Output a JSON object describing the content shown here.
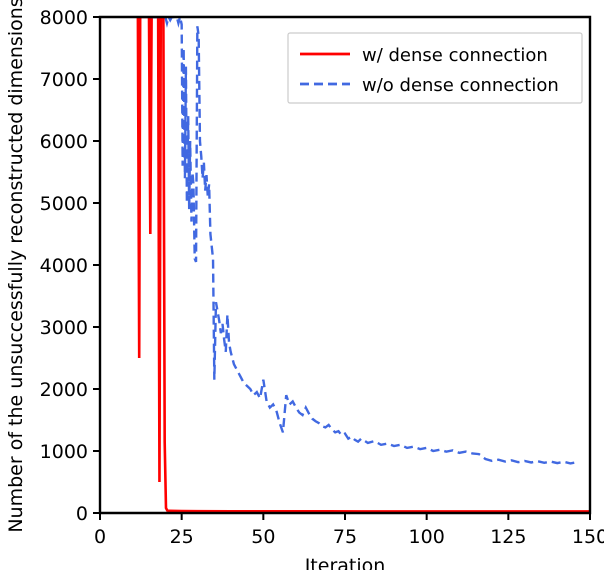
{
  "chart_data": {
    "type": "line",
    "title": "",
    "xlabel": "Iteration",
    "ylabel": "Number of the unsuccessfully reconstructed dimensions",
    "xlim": [
      0,
      150
    ],
    "ylim": [
      0,
      8000
    ],
    "xticks": [
      0,
      25,
      50,
      75,
      100,
      125,
      150
    ],
    "yticks": [
      0,
      1000,
      2000,
      3000,
      4000,
      5000,
      6000,
      7000,
      8000
    ],
    "xtick_labels": [
      "0",
      "25",
      "50",
      "75",
      "100",
      "125",
      "150"
    ],
    "ytick_labels": [
      "0",
      "1000",
      "2000",
      "3000",
      "4000",
      "5000",
      "6000",
      "7000",
      "8000"
    ],
    "grid": false,
    "legend_position": "upper right",
    "series": [
      {
        "name": "w/ dense connection",
        "color": "#ff0000",
        "linestyle": "solid",
        "linewidth": 2.6,
        "x": [
          11.6,
          12.0,
          12.3,
          12.6,
          13.0,
          13.4,
          13.8,
          14.2,
          14.6,
          15.0,
          15.4,
          15.8,
          16.2,
          16.6,
          17.0,
          17.4,
          17.8,
          18.2,
          18.6,
          19.0,
          19.4,
          19.8,
          20.2,
          20.6,
          21.0,
          25,
          30,
          40,
          50,
          60,
          70,
          80,
          90,
          100,
          110,
          120,
          130,
          140,
          150
        ],
        "y": [
          8000,
          2500,
          8000,
          8000,
          8000,
          8000,
          8000,
          8000,
          8000,
          8000,
          4500,
          8000,
          8000,
          8000,
          8000,
          8000,
          8000,
          500,
          8000,
          8000,
          8000,
          1150,
          80,
          40,
          35,
          32,
          30,
          28,
          28,
          27,
          27,
          26,
          26,
          25,
          25,
          25,
          25,
          25,
          25
        ]
      },
      {
        "name": "w/o dense connection",
        "color": "#4169e1",
        "linestyle": "dashed",
        "linewidth": 2.4,
        "x": [
          15.5,
          16,
          16.5,
          17,
          17.5,
          18,
          18.5,
          19,
          19.5,
          20,
          20.5,
          21,
          21.5,
          22,
          22.5,
          23,
          23.5,
          24,
          24.5,
          25,
          25.3,
          25.6,
          26,
          26.3,
          26.6,
          27,
          27.3,
          27.6,
          28,
          28.3,
          28.6,
          29,
          29.4,
          29.8,
          30.2,
          30.6,
          31,
          31.4,
          31.8,
          32.2,
          32.6,
          33,
          33.4,
          33.8,
          34.2,
          34.6,
          35,
          35.5,
          36,
          36.5,
          37,
          37.5,
          38,
          38.5,
          39,
          39.5,
          40,
          40.5,
          41,
          41.5,
          42,
          42.5,
          43,
          43.5,
          44,
          45,
          46,
          47,
          48,
          49,
          50,
          51,
          52,
          53,
          54,
          55,
          56,
          57,
          58,
          59,
          60,
          61,
          62,
          63,
          64,
          65,
          66,
          67,
          68,
          69,
          70,
          71,
          72,
          73,
          74,
          75,
          76,
          77,
          78,
          79,
          80,
          82,
          84,
          86,
          88,
          90,
          92,
          94,
          96,
          98,
          100,
          102,
          104,
          106,
          108,
          110,
          112,
          114,
          116,
          118,
          120,
          122,
          124,
          126,
          128,
          130,
          132,
          134,
          136,
          138,
          140,
          142,
          144,
          146,
          148,
          150
        ],
        "y": [
          8000,
          8000,
          8000,
          8000,
          8000,
          8000,
          8000,
          8000,
          8000,
          8000,
          7900,
          8000,
          7950,
          8000,
          8000,
          8000,
          8000,
          7900,
          8000,
          7880,
          5600,
          7500,
          5400,
          7200,
          5000,
          6400,
          4900,
          6000,
          4700,
          5500,
          5300,
          4100,
          4050,
          7850,
          7700,
          6000,
          5750,
          5400,
          5650,
          5200,
          5450,
          5100,
          5300,
          4500,
          4300,
          4100,
          2150,
          3400,
          3250,
          3100,
          2900,
          3050,
          2800,
          2600,
          3200,
          2750,
          2600,
          2500,
          2400,
          2350,
          2300,
          2250,
          2200,
          2150,
          2100,
          2050,
          2000,
          1900,
          1950,
          1850,
          2150,
          1800,
          1700,
          1750,
          1650,
          1450,
          1300,
          1900,
          1750,
          1800,
          1700,
          1620,
          1580,
          1700,
          1600,
          1520,
          1480,
          1450,
          1400,
          1380,
          1420,
          1350,
          1300,
          1320,
          1250,
          1280,
          1200,
          1230,
          1180,
          1150,
          1200,
          1130,
          1160,
          1100,
          1120,
          1080,
          1100,
          1050,
          1070,
          1030,
          1050,
          1000,
          1020,
          990,
          1010,
          970,
          990,
          960,
          950,
          870,
          840,
          860,
          830,
          850,
          820,
          840,
          815,
          835,
          810,
          830,
          805,
          825,
          800,
          820
        ]
      }
    ]
  },
  "legend": {
    "entries": [
      {
        "label": "w/ dense connection",
        "color": "#ff0000",
        "style": "solid"
      },
      {
        "label": "w/o dense connection",
        "color": "#4169e1",
        "style": "dashed"
      }
    ]
  },
  "axes": {
    "x_title": "Iteration",
    "y_title": "Number of the unsuccessfully reconstructed dimensions"
  }
}
